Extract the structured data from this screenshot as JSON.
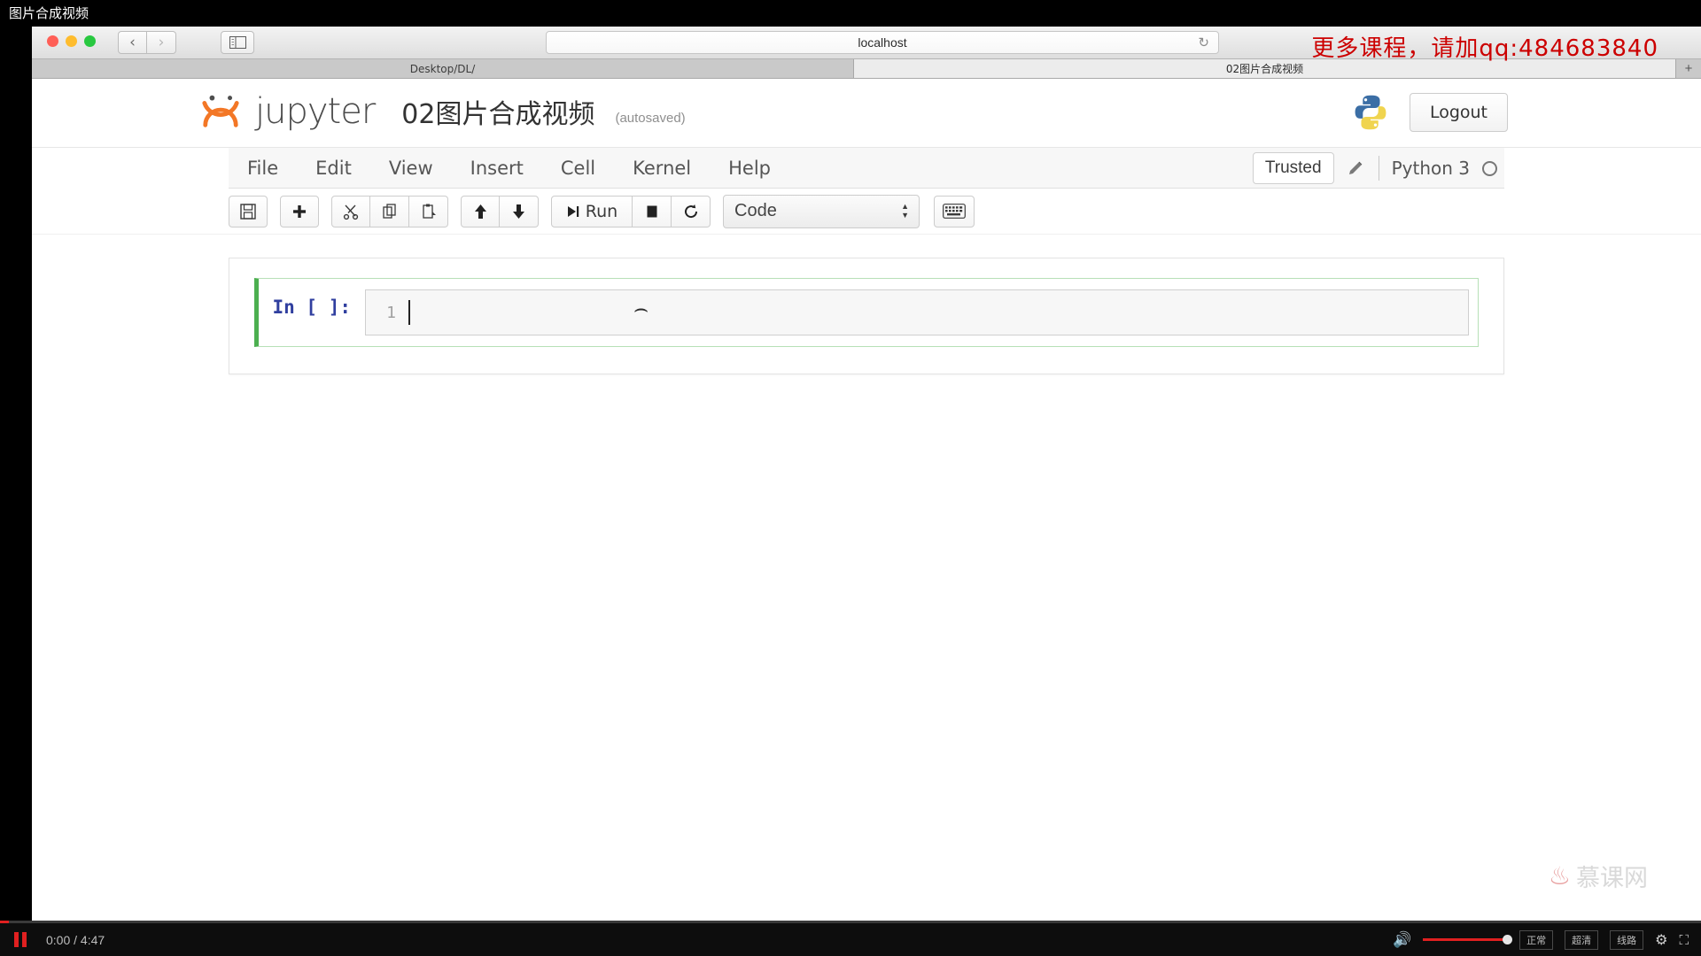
{
  "video": {
    "title": "图片合成视频",
    "current_time": "0:00",
    "duration": "4:47",
    "time_display": "0:00 / 4:47",
    "pause_label": "pause",
    "quality_options": [
      "正常",
      "超清",
      "线路"
    ]
  },
  "promo": {
    "text": "更多课程，请加qq:484683840",
    "color": "#cc0000"
  },
  "browser": {
    "back_glyph": "‹",
    "forward_glyph": "›",
    "address": "localhost",
    "reload_glyph": "↻",
    "tabs": [
      {
        "label": "Desktop/DL/",
        "active": false
      },
      {
        "label": "02图片合成视频",
        "active": true
      }
    ],
    "new_tab_glyph": "+"
  },
  "jupyter": {
    "wordmark": "jupyter",
    "notebook_name": "02图片合成视频",
    "autosave_status": "(autosaved)",
    "logout_label": "Logout",
    "menus": [
      "File",
      "Edit",
      "View",
      "Insert",
      "Cell",
      "Kernel",
      "Help"
    ],
    "trusted_label": "Trusted",
    "kernel_label": "Python 3",
    "toolbar": {
      "save": "💾",
      "insert_below": "✚",
      "cut": "✂",
      "copy": "⎘",
      "paste": "📋",
      "move_up": "↑",
      "move_down": "↓",
      "run_glyph": "▶|",
      "run_label": "Run",
      "stop": "■",
      "restart": "↻",
      "cell_type": "Code",
      "keyboard": "⌨"
    },
    "cell": {
      "prompt": "In [ ]:",
      "line_number": "1",
      "code": ""
    }
  },
  "watermark": {
    "text": "慕课网",
    "flame": "🔥"
  }
}
